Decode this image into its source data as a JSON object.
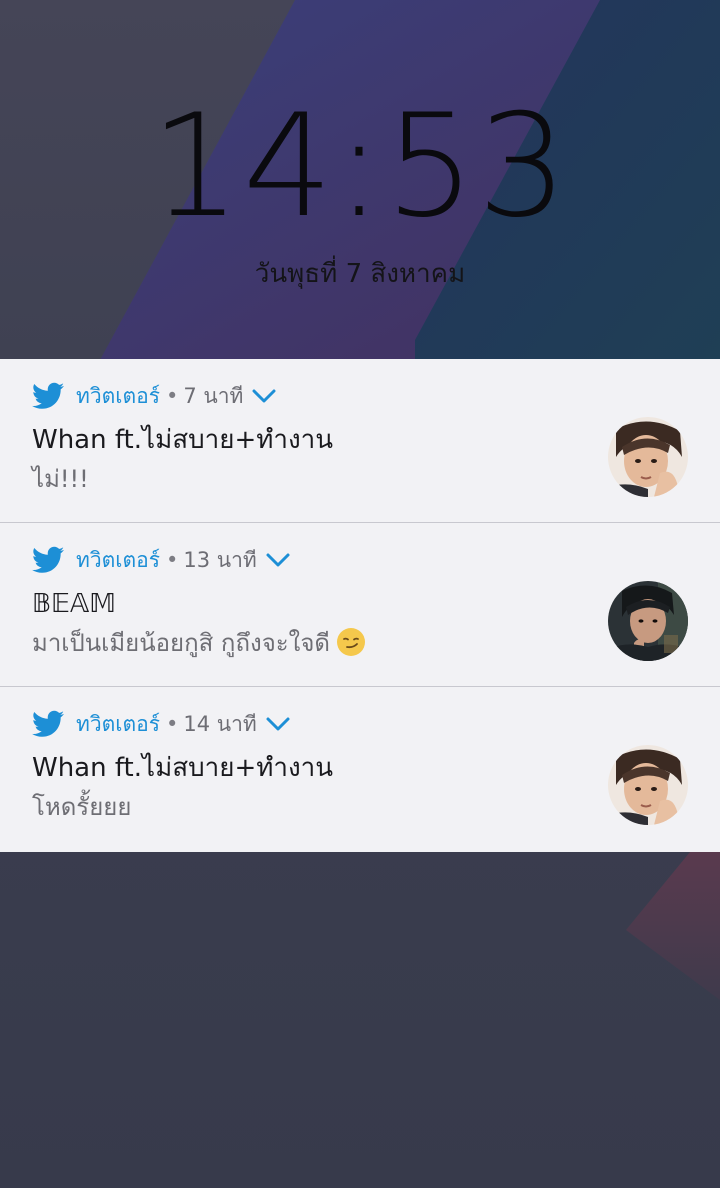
{
  "lockscreen": {
    "time": "14:53",
    "date": "วันพุธที่ 7 สิงหาคม"
  },
  "colors": {
    "accent": "#1d8fd6",
    "card_background": "#f2f2f5"
  },
  "notifications": [
    {
      "app_icon": "twitter-bird-icon",
      "app_name": "ทวิตเตอร์",
      "separator": "•",
      "time_ago": "7 นาที",
      "title": "Whan ft.ไม่สบาย+ทำงาน",
      "message": "ไม่!!!",
      "avatar": "sender-avatar"
    },
    {
      "app_icon": "twitter-bird-icon",
      "app_name": "ทวิตเตอร์",
      "separator": "•",
      "time_ago": "13 นาที",
      "title": "𝔹𝔼𝔸𝕄",
      "message": "มาเป็นเมียน้อยกูสิ กูถึงจะใจดี",
      "message_emoji": "smirking-face-emoji",
      "avatar": "sender-avatar"
    },
    {
      "app_icon": "twitter-bird-icon",
      "app_name": "ทวิตเตอร์",
      "separator": "•",
      "time_ago": "14 นาที",
      "title": "Whan ft.ไม่สบาย+ทำงาน",
      "message": "โหดรั้ยยย",
      "avatar": "sender-avatar"
    }
  ]
}
